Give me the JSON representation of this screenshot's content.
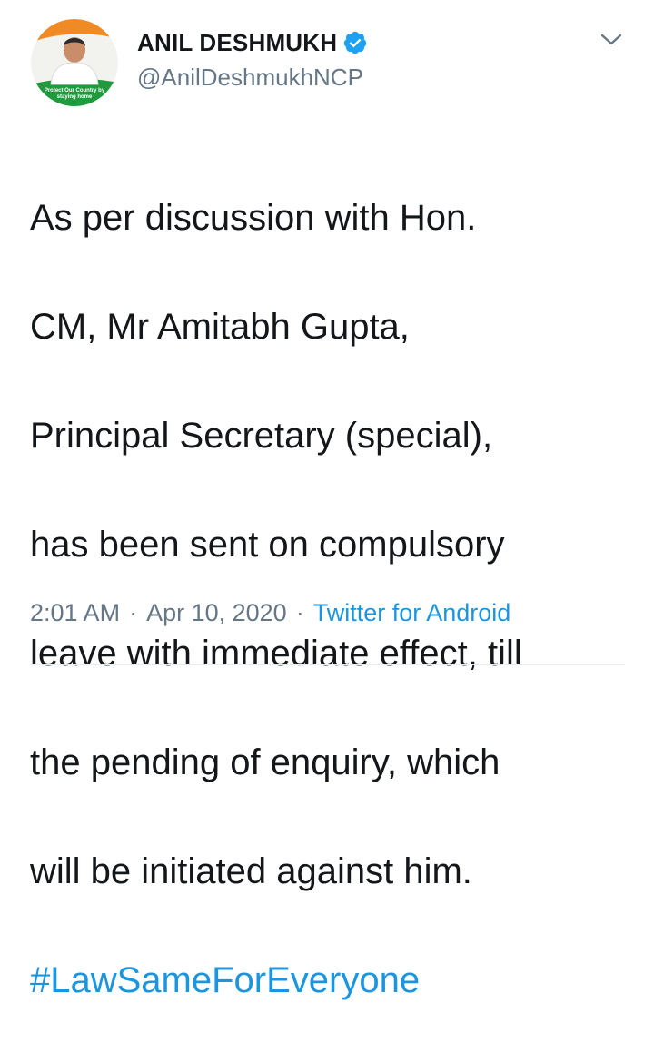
{
  "tweet": {
    "author": {
      "display_name": "ANIL DESHMUKH",
      "handle": "@AnilDeshmukhNCP",
      "verified": true,
      "avatar_caption": "Protect Our Country by staying home"
    },
    "text_lines": [
      "As per discussion with Hon.",
      "CM, Mr Amitabh Gupta,",
      "Principal Secretary (special),",
      "has been sent on compulsory",
      "leave with immediate effect, till",
      "the pending of enquiry, which",
      "will be initiated against him."
    ],
    "hashtag": "#LawSameForEveryone",
    "time": "2:01 AM",
    "date": "Apr 10, 2020",
    "separator": "·",
    "source": "Twitter for Android"
  },
  "icons": {
    "verified_badge": "verified-badge-icon",
    "more_options": "chevron-down-icon"
  },
  "colors": {
    "link": "#1b95e0",
    "muted": "#657786",
    "text": "#14171a",
    "verified": "#1da1f2"
  }
}
